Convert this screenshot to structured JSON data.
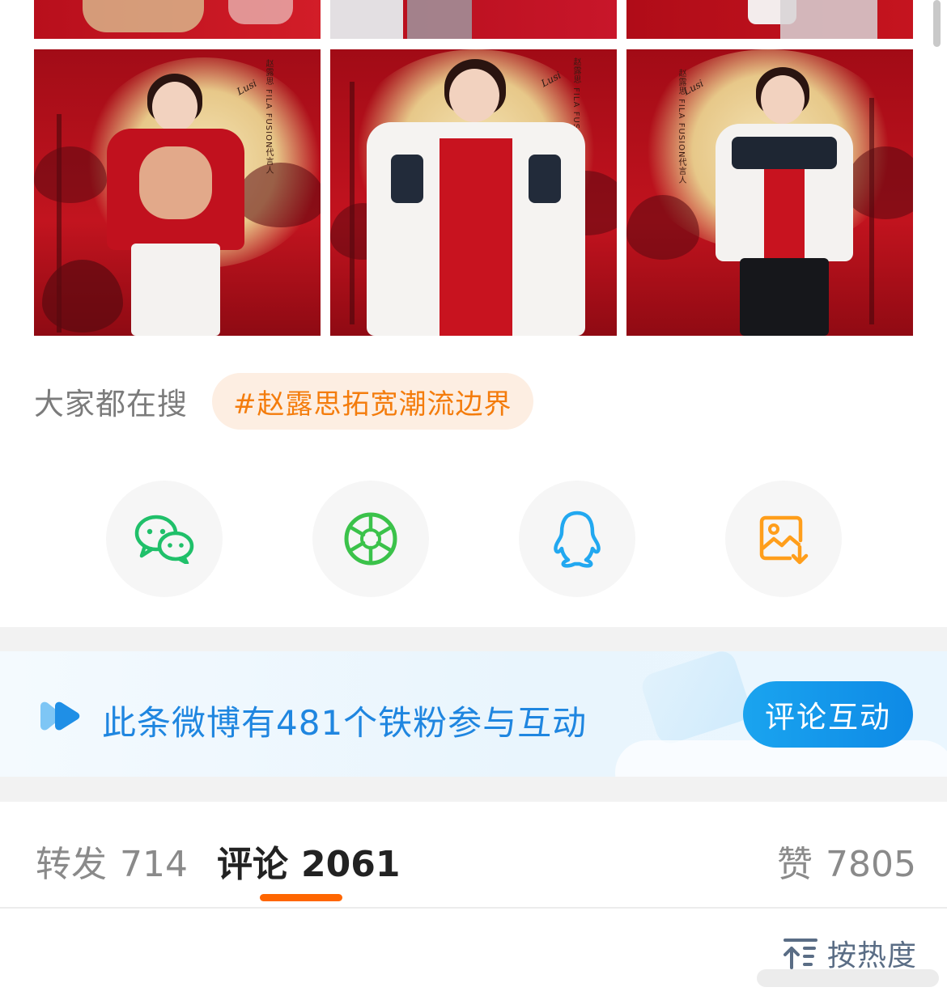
{
  "photos": {
    "top_row": [
      {
        "name": "photo-top-left"
      },
      {
        "name": "photo-top-center"
      },
      {
        "name": "photo-top-right"
      }
    ],
    "row": [
      {
        "name": "photo-row2-left",
        "caption": "赵露思 FILA FUSION代言人"
      },
      {
        "name": "photo-row2-center",
        "caption": "赵露思 FILA FUSION代言人"
      },
      {
        "name": "photo-row2-right",
        "caption": "赵露思 FILA FUSION代言人"
      }
    ]
  },
  "search": {
    "label": "大家都在搜",
    "tag": "#赵露思拓宽潮流边界"
  },
  "share": {
    "items": [
      {
        "icon": "wechat-icon",
        "color": "#20c06a"
      },
      {
        "icon": "moments-icon",
        "color": "#3bc24a"
      },
      {
        "icon": "qq-icon",
        "color": "#22a8f0"
      },
      {
        "icon": "save-image-icon",
        "color": "#ff9e1b"
      }
    ]
  },
  "fan_banner": {
    "text": "此条微博有481个铁粉参与互动",
    "button": "评论互动",
    "icon": "fan-badge-icon"
  },
  "tabs": [
    {
      "label": "转发",
      "count": "714"
    },
    {
      "label": "评论",
      "count": "2061"
    },
    {
      "label": "赞",
      "count": "7805"
    }
  ],
  "active_tab": "评论",
  "sort": {
    "label": "按热度",
    "icon": "sort-icon"
  },
  "colors": {
    "accent_orange": "#ff6600",
    "tag_text": "#f47c0c",
    "tag_bg": "#fdeee2",
    "fan_text": "#1f86e0",
    "fan_button": "#0e8ae6"
  }
}
